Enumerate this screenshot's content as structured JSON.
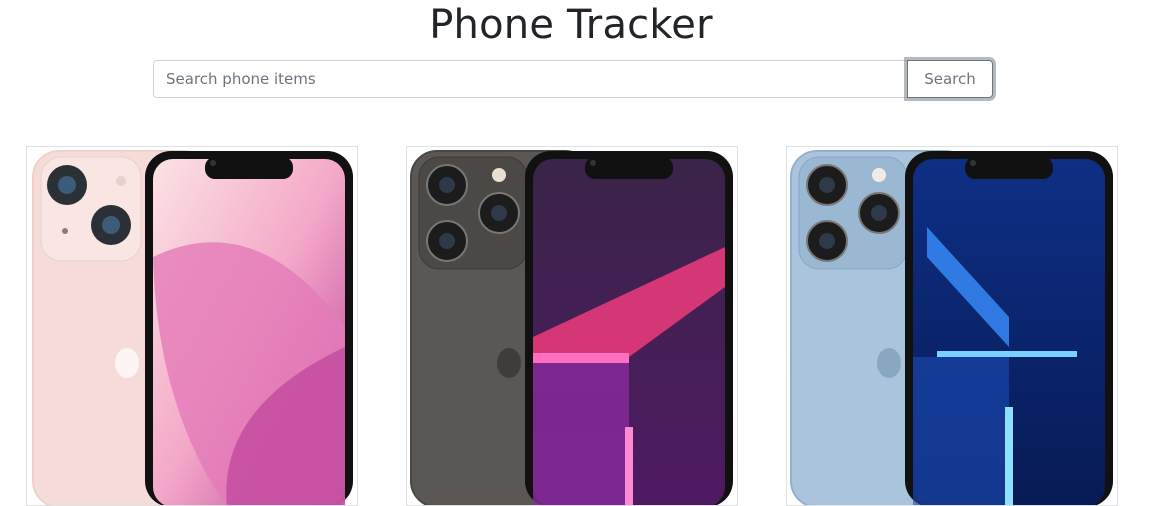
{
  "header": {
    "title": "Phone Tracker"
  },
  "search": {
    "placeholder": "Search phone items",
    "value": "",
    "button_label": "Search"
  },
  "products": [
    {
      "name": "phone-card-pink",
      "body_color": "#f6dcd8",
      "screen_top": "#f8c9d8",
      "screen_bottom": "#c04fa0",
      "accent": "#e27ab7"
    },
    {
      "name": "phone-card-graphite",
      "body_color": "#5a5754",
      "screen_top": "#3b1f4d",
      "screen_bottom": "#5a1f6e",
      "accent": "#e63a7a"
    },
    {
      "name": "phone-card-sierra-blue",
      "body_color": "#a9c4dc",
      "screen_top": "#0e2f85",
      "screen_bottom": "#0a1f5c",
      "accent": "#58b8ff"
    }
  ]
}
